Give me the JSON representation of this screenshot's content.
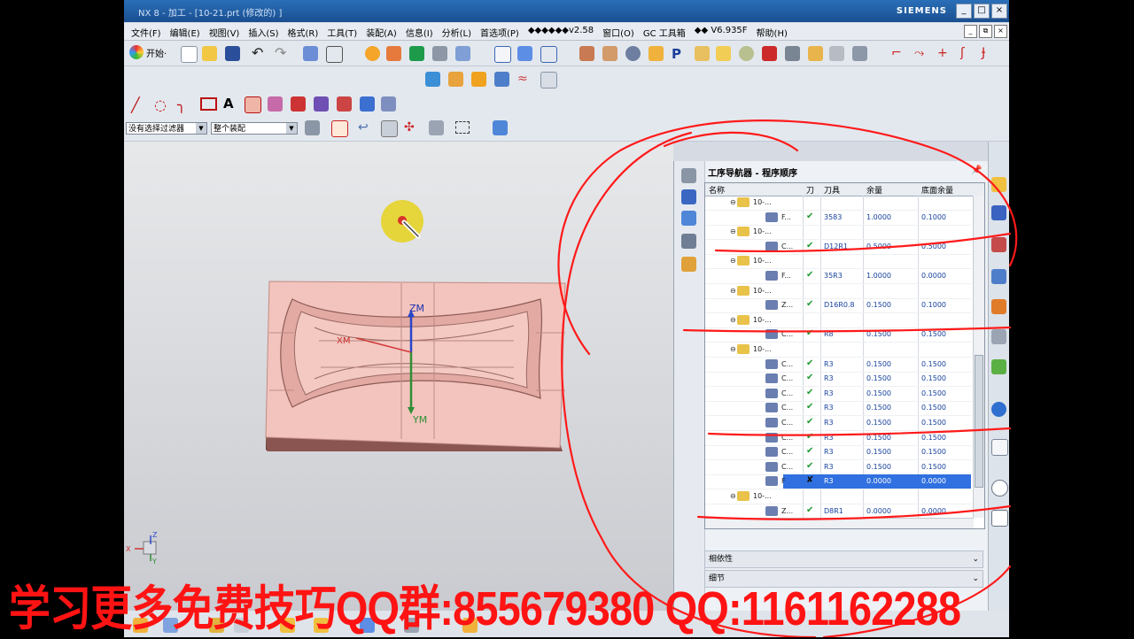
{
  "window": {
    "title": "NX 8 - 加工 - [10-21.prt (修改的) ]",
    "brand": "SIEMENS",
    "controls": [
      "_",
      "□",
      "×"
    ]
  },
  "menu": {
    "items": [
      "文件(F)",
      "编辑(E)",
      "视图(V)",
      "插入(S)",
      "格式(R)",
      "工具(T)",
      "装配(A)",
      "信息(I)",
      "分析(L)",
      "首选项(P)",
      "◆◆◆◆◆◆v2.58",
      "窗口(O)",
      "GC 工具箱",
      "◆◆ V6.935F",
      "帮助(H)"
    ],
    "mini_controls": [
      "_",
      "⧉",
      "×"
    ]
  },
  "toolbar": {
    "start_label": "开始·"
  },
  "filters": {
    "selection_filter": "没有选择过滤器",
    "assembly_scope": "整个装配"
  },
  "viewport": {
    "labels": {
      "zm": "ZM",
      "ym": "YM",
      "xm": "XM"
    },
    "triad": {
      "x": "X",
      "y": "Y",
      "z": "Z"
    }
  },
  "navigator": {
    "title": "工序导航器 - 程序顺序",
    "columns": [
      "名称",
      "刀",
      "刀具",
      "余量",
      "底面余量"
    ],
    "rows": [
      {
        "name": "10-...",
        "group": true,
        "ok": "",
        "tool": "",
        "stock": "",
        "floor": ""
      },
      {
        "name": "F...",
        "group": false,
        "ok": "✔",
        "tool": "3583",
        "stock": "1.0000",
        "floor": "0.1000"
      },
      {
        "name": "10-...",
        "group": true,
        "ok": "",
        "tool": "",
        "stock": "",
        "floor": ""
      },
      {
        "name": "C...",
        "group": false,
        "ok": "✔",
        "tool": "D12R1",
        "stock": "0.5000",
        "floor": "0.5000"
      },
      {
        "name": "10-...",
        "group": true,
        "ok": "",
        "tool": "",
        "stock": "",
        "floor": ""
      },
      {
        "name": "F...",
        "group": false,
        "ok": "✔",
        "tool": "35R3",
        "stock": "1.0000",
        "floor": "0.0000"
      },
      {
        "name": "10-...",
        "group": true,
        "ok": "",
        "tool": "",
        "stock": "",
        "floor": ""
      },
      {
        "name": "Z...",
        "group": false,
        "ok": "✔",
        "tool": "D16R0.8",
        "stock": "0.1500",
        "floor": "0.1000"
      },
      {
        "name": "10-...",
        "group": true,
        "ok": "",
        "tool": "",
        "stock": "",
        "floor": ""
      },
      {
        "name": "C...",
        "group": false,
        "ok": "✔",
        "tool": "R8",
        "stock": "0.1500",
        "floor": "0.1500"
      },
      {
        "name": "10-...",
        "group": true,
        "ok": "",
        "tool": "",
        "stock": "",
        "floor": ""
      },
      {
        "name": "C...",
        "group": false,
        "ok": "✔",
        "tool": "R3",
        "stock": "0.1500",
        "floor": "0.1500"
      },
      {
        "name": "C...",
        "group": false,
        "ok": "✔",
        "tool": "R3",
        "stock": "0.1500",
        "floor": "0.1500"
      },
      {
        "name": "C...",
        "group": false,
        "ok": "✔",
        "tool": "R3",
        "stock": "0.1500",
        "floor": "0.1500"
      },
      {
        "name": "C...",
        "group": false,
        "ok": "✔",
        "tool": "R3",
        "stock": "0.1500",
        "floor": "0.1500"
      },
      {
        "name": "C...",
        "group": false,
        "ok": "✔",
        "tool": "R3",
        "stock": "0.1500",
        "floor": "0.1500"
      },
      {
        "name": "C...",
        "group": false,
        "ok": "✔",
        "tool": "R3",
        "stock": "0.1500",
        "floor": "0.1500"
      },
      {
        "name": "C...",
        "group": false,
        "ok": "✔",
        "tool": "R3",
        "stock": "0.1500",
        "floor": "0.1500"
      },
      {
        "name": "C...",
        "group": false,
        "ok": "✔",
        "tool": "R3",
        "stock": "0.1500",
        "floor": "0.1500"
      },
      {
        "name": "F",
        "group": false,
        "ok": "✘",
        "tool": "R3",
        "stock": "0.0000",
        "floor": "0.0000",
        "selected": true
      },
      {
        "name": "10-...",
        "group": true,
        "ok": "",
        "tool": "",
        "stock": "",
        "floor": ""
      },
      {
        "name": "Z...",
        "group": false,
        "ok": "✔",
        "tool": "D8R1",
        "stock": "0.0000",
        "floor": "0.0000"
      }
    ],
    "sections": [
      "相依性",
      "细节"
    ]
  },
  "overlay": {
    "watermark": "学习更多免费技巧QQ群:855679380   QQ:1161162288",
    "color": "#ff1313"
  }
}
